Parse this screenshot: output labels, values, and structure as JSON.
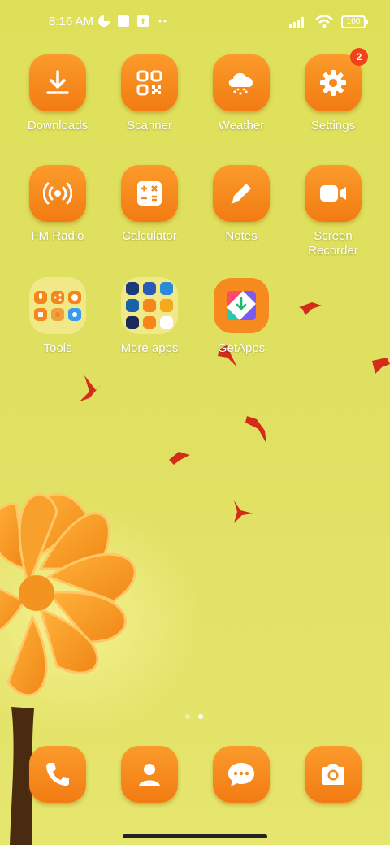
{
  "status_bar": {
    "time": "8:16 AM",
    "battery": "100",
    "left_icons": [
      "data-saver-icon",
      "notification-square-icon",
      "upload-notification-icon",
      "more-dots-icon"
    ],
    "right_icons": [
      "signal-icon",
      "wifi-icon",
      "battery-icon"
    ]
  },
  "apps": [
    {
      "label": "Downloads",
      "icon": "download-icon"
    },
    {
      "label": "Scanner",
      "icon": "qr-scanner-icon"
    },
    {
      "label": "Weather",
      "icon": "weather-icon"
    },
    {
      "label": "Settings",
      "icon": "gear-icon",
      "badge": "2"
    },
    {
      "label": "FM Radio",
      "icon": "radio-icon"
    },
    {
      "label": "Calculator",
      "icon": "calculator-icon"
    },
    {
      "label": "Notes",
      "icon": "pencil-icon"
    },
    {
      "label": "Screen\nRecorder",
      "icon": "video-camera-icon"
    },
    {
      "label": "Tools",
      "icon": "folder-icon"
    },
    {
      "label": "More apps",
      "icon": "folder-icon"
    },
    {
      "label": "GetApps",
      "icon": "getapps-icon"
    }
  ],
  "dock": [
    {
      "icon": "phone-icon"
    },
    {
      "icon": "contacts-icon"
    },
    {
      "icon": "messages-icon"
    },
    {
      "icon": "camera-icon"
    }
  ],
  "pager": {
    "count": 2,
    "active": 2
  },
  "colors": {
    "wallpaper": "#dfe05a",
    "icon_orange": "#f68a1e",
    "badge": "#f1421b",
    "bird": "#d42c1a"
  }
}
